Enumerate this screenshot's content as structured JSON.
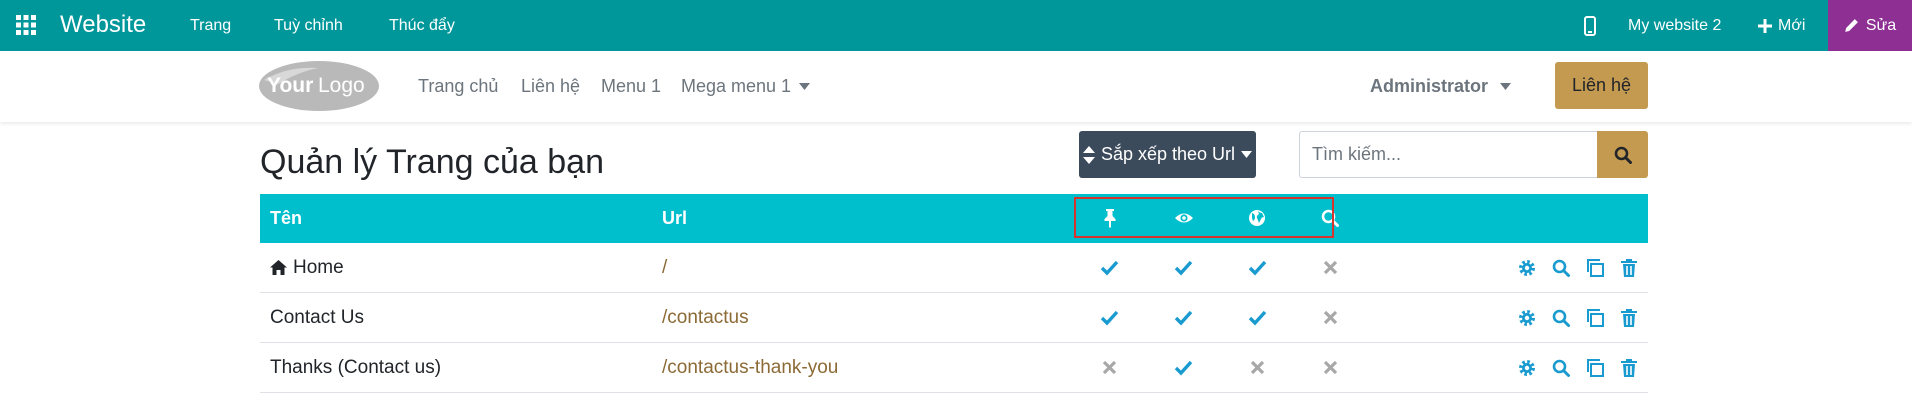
{
  "topbar": {
    "app_title": "Website",
    "menus": [
      "Trang",
      "Tuỳ chỉnh",
      "Thúc đẩy"
    ],
    "site_name": "My website 2",
    "new_label": "Mới",
    "edit_label": "Sửa",
    "icons": {
      "apps": "apps-grid-icon",
      "mobile": "mobile-preview-icon",
      "plus": "plus-icon",
      "pencil": "pencil-icon"
    }
  },
  "header": {
    "logo": {
      "word1": "Your",
      "word2": "Logo"
    },
    "nav": [
      "Trang chủ",
      "Liên hệ",
      "Menu 1",
      "Mega menu 1"
    ],
    "user": "Administrator",
    "contact_button": "Liên hệ"
  },
  "page": {
    "title": "Quản lý Trang của bạn",
    "sort_label": "Sắp xếp theo Url",
    "search_placeholder": "Tìm kiếm..."
  },
  "table": {
    "columns": {
      "name": "Tên",
      "url": "Url",
      "icons": [
        "pin-icon",
        "eye-icon",
        "globe-icon",
        "search-icon"
      ]
    },
    "rows": [
      {
        "name": "Home",
        "home_icon": true,
        "url": "/",
        "flags": [
          true,
          true,
          true,
          false
        ]
      },
      {
        "name": "Contact Us",
        "home_icon": false,
        "url": "/contactus",
        "flags": [
          true,
          true,
          true,
          false
        ]
      },
      {
        "name": "Thanks (Contact us)",
        "home_icon": false,
        "url": "/contactus-thank-you",
        "flags": [
          false,
          true,
          false,
          false
        ]
      }
    ],
    "actions": [
      "gear-icon",
      "search-icon",
      "clone-icon",
      "trash-icon"
    ]
  },
  "colors": {
    "topbar": "#00979a",
    "edit": "#8e2f93",
    "table_header": "#00bfcc",
    "accent_gold": "#c49a50",
    "sort_button": "#3c4b5b",
    "check": "#1a9bd0",
    "cross": "#a8a8a8",
    "highlight_box": "#d9342b"
  }
}
